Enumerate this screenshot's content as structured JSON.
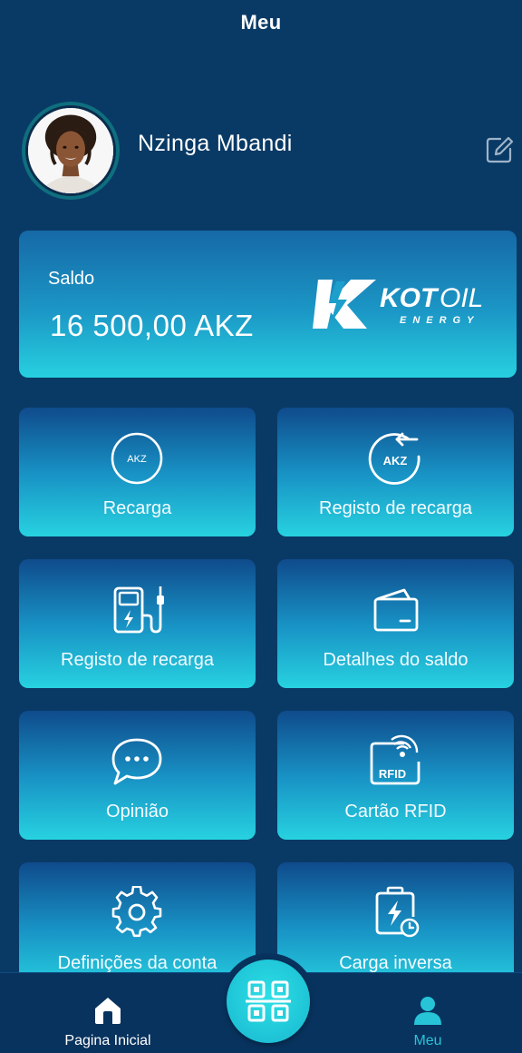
{
  "header": {
    "title": "Meu"
  },
  "profile": {
    "name": "Nzinga Mbandi",
    "avatar_icon": "user-avatar",
    "edit_icon": "edit-icon"
  },
  "balance": {
    "label": "Saldo",
    "value": "16 500,00 AKZ",
    "logo": {
      "brand": "KOTOIL",
      "brand_part1": "KOT",
      "brand_part2": "OIL",
      "subtitle": "ENERGY"
    }
  },
  "menu": [
    {
      "label": "Recarga",
      "icon": "akz-coin-icon"
    },
    {
      "label": "Registo de recarga",
      "icon": "akz-history-icon"
    },
    {
      "label": "Registo de recarga",
      "icon": "charging-station-icon"
    },
    {
      "label": "Detalhes do saldo",
      "icon": "wallet-icon"
    },
    {
      "label": "Opinião",
      "icon": "chat-bubble-icon"
    },
    {
      "label": "Cartão RFID",
      "icon": "rfid-card-icon"
    },
    {
      "label": "Definições da conta",
      "icon": "gear-icon"
    },
    {
      "label": "Carga inversa",
      "icon": "reverse-charge-icon"
    }
  ],
  "icon_text": {
    "akz": "AKZ",
    "rfid": "RFID"
  },
  "bottom_nav": {
    "home": {
      "label": "Pagina Inicial",
      "icon": "home-icon"
    },
    "scan": {
      "icon": "qr-scan-icon"
    },
    "me": {
      "label": "Meu",
      "icon": "person-icon"
    }
  },
  "colors": {
    "background": "#093a66",
    "accent": "#27c4d8",
    "tile_gradient_top": "#0f4b8c",
    "tile_gradient_bottom": "#27d2e0"
  }
}
